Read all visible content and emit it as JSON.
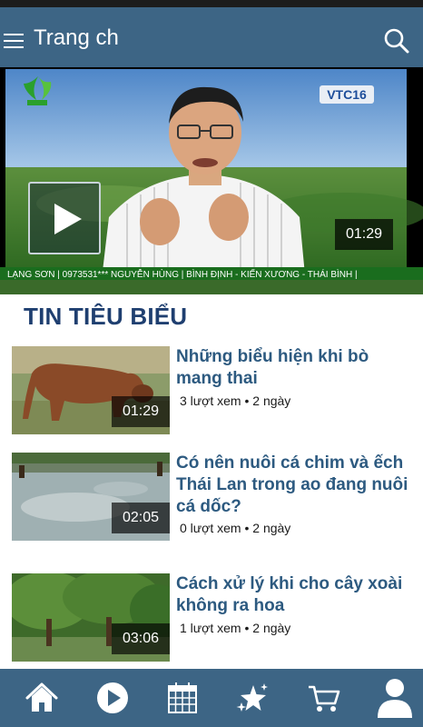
{
  "appbar": {
    "title": "Trang ch",
    "menu_icon": "hamburger-menu-icon",
    "search_icon": "search-icon"
  },
  "featured": {
    "duration": "01:29",
    "play_icon": "play-icon",
    "channel_badge": "VTC16",
    "ticker_text": "LẠNG SƠN | 0973531*** NGUYỄN HÙNG | BÌNH ĐỊNH - KIẾN XƯƠNG - THÁI BÌNH |"
  },
  "section": {
    "title": "TIN TIÊU BIỂU"
  },
  "items": [
    {
      "title": "Những biểu hiện khi bò mang thai",
      "views": "3 lượt xem",
      "age": "2 ngày",
      "duration": "01:29"
    },
    {
      "title": "Có nên nuôi cá chim và ếch Thái Lan trong ao đang nuôi cá dốc?",
      "views": "0 lượt xem",
      "age": "2 ngày",
      "duration": "02:05"
    },
    {
      "title": "Cách xử lý khi cho cây xoài không ra hoa",
      "views": "1 lượt xem",
      "age": "2 ngày",
      "duration": "03:06"
    }
  ],
  "meta_separator": "•",
  "bottom_nav": [
    {
      "icon": "home-icon"
    },
    {
      "icon": "play-circle-icon"
    },
    {
      "icon": "calendar-icon"
    },
    {
      "icon": "sparkle-star-icon"
    },
    {
      "icon": "shopping-cart-icon"
    },
    {
      "icon": "user-profile-icon"
    }
  ],
  "colors": {
    "bar_background": "#3d6585",
    "section_title": "#1f3f70",
    "item_title": "#2d5a80"
  }
}
